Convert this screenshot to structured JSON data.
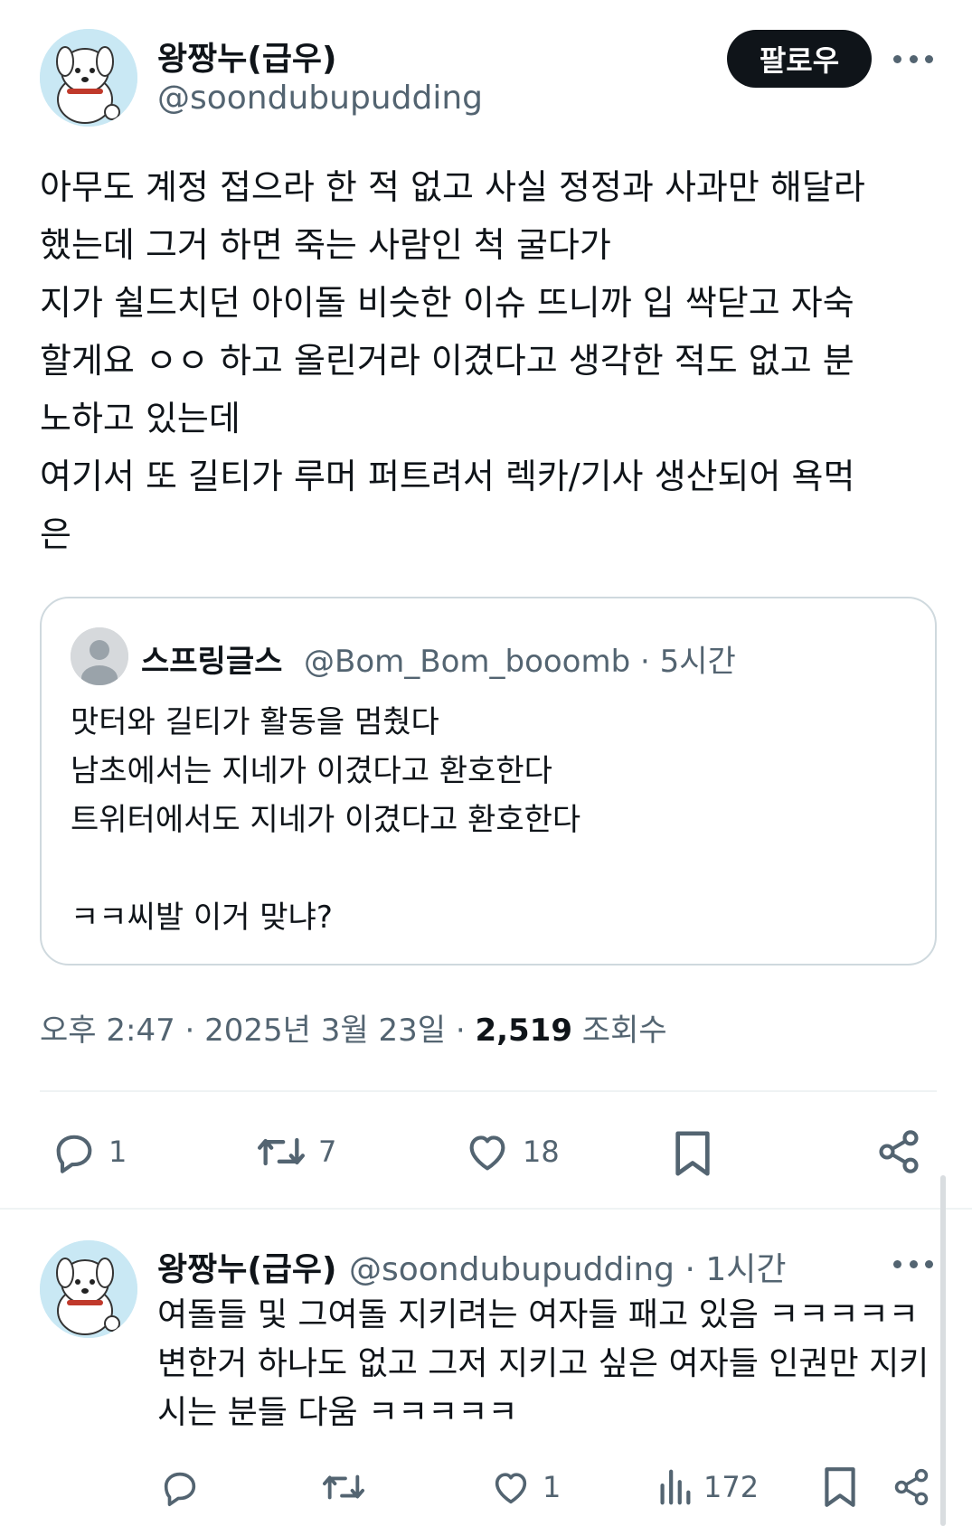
{
  "tweet": {
    "author_name": "왕짱누(급우)",
    "author_handle": "@soondubupudding",
    "follow_label": "팔로우",
    "text_lines": [
      "아무도 계정 접으라 한 적 없고 사실 정정과 사과만 해달라",
      "했는데 그거 하면 죽는 사람인 척 굴다가",
      "지가 쉴드치던 아이돌 비슷한 이슈 뜨니까 입 싹닫고 자숙",
      "할게요 ㅇㅇ 하고 올린거라 이겼다고 생각한 적도 없고 분",
      "노하고 있는데",
      "여기서 또 길티가 루머 퍼트려서 렉카/기사 생산되어 욕먹",
      "은"
    ],
    "quote": {
      "author_name": "스프링글스",
      "author_handle": "@Bom_Bom_booomb · 5시간",
      "text_lines": [
        "맛터와 길티가 활동을 멈췄다",
        "남초에서는 지네가 이겼다고 환호한다",
        "트위터에서도 지네가 이겼다고 환호한다",
        "",
        "ㅋㅋ씨발 이거 맞냐?"
      ]
    },
    "timestamp": "오후 2:47 · 2025년 3월 23일 · ",
    "views_count": "2,519",
    "views_label": " 조회수",
    "actions": {
      "replies": "1",
      "retweets": "7",
      "likes": "18"
    }
  },
  "reply": {
    "author_name": "왕짱누(급우)",
    "author_handle": "@soondubupudding · 1시간",
    "text_lines": [
      "여돌들 및 그여돌 지키려는 여자들 패고 있음 ㅋㅋㅋㅋㅋ",
      "변한거 하나도 없고 그저 지키고 싶은 여자들 인권만 지키",
      "시는 분들 다움 ㅋㅋㅋㅋㅋ"
    ],
    "actions": {
      "likes": "1",
      "views": "172"
    }
  },
  "colors": {
    "text": "#0f1419",
    "secondary": "#536471",
    "border": "#cfd9de",
    "avatar_bg": "#c9e8f4"
  },
  "icons": [
    "more-icon",
    "reply-icon",
    "retweet-icon",
    "like-icon",
    "bookmark-icon",
    "share-icon",
    "views-icon"
  ]
}
